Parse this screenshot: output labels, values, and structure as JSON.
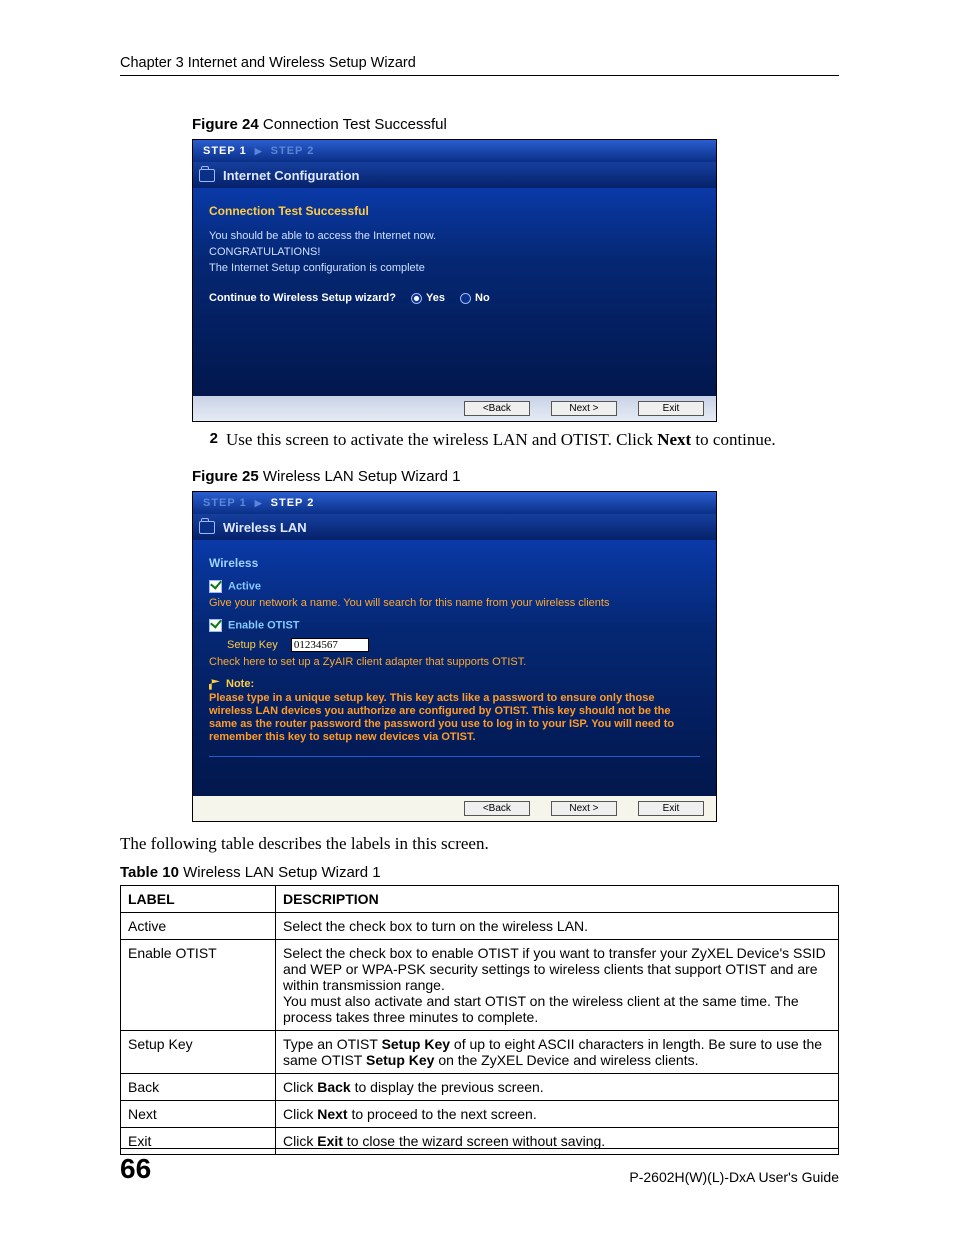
{
  "chapter": "Chapter 3 Internet and Wireless Setup Wizard",
  "page_number": "66",
  "guide_title": "P-2602H(W)(L)-DxA User's Guide",
  "fig24": {
    "caption_bold": "Figure 24",
    "caption_rest": "   Connection Test Successful",
    "step1": "STEP 1",
    "step2": "STEP 2",
    "title": "Internet Configuration",
    "sub": "Connection Test Successful",
    "line1": "You should be able to access the Internet now.",
    "line2": "CONGRATULATIONS!",
    "line3": "The Internet Setup configuration is complete",
    "question": "Continue to Wireless Setup wizard?",
    "yes": "Yes",
    "no": "No",
    "back": "<Back",
    "next": "Next >",
    "exit": "Exit"
  },
  "step2text": {
    "num": "2",
    "pre": "Use this screen to activate the wireless LAN and OTIST. Click ",
    "bold": "Next",
    "post": " to continue."
  },
  "fig25": {
    "caption_bold": "Figure 25",
    "caption_rest": "   Wireless LAN Setup Wizard 1",
    "step1": "STEP 1",
    "step2": "STEP 2",
    "title": "Wireless LAN",
    "sub": "Wireless",
    "active": "Active",
    "help1": "Give your network a name. You will search for this name from your wireless clients",
    "enable": "Enable OTIST",
    "setupkey_label": "Setup Key",
    "setupkey_value": "01234567",
    "help2": "Check here to set up a ZyAIR client adapter that supports OTIST.",
    "note_head": "Note:",
    "note_body": "Please type in a unique setup key. This key acts like a password to ensure only those wireless LAN devices you authorize are configured by OTIST. This key should not be the same as the router password the password you use to log in to your ISP. You will need to remember this key to setup new devices via OTIST.",
    "back": "<Back",
    "next": "Next >",
    "exit": "Exit"
  },
  "after_table_text": "The following table describes the labels in this screen.",
  "table_caption_bold": "Table 10",
  "table_caption_rest": "   Wireless LAN Setup Wizard 1",
  "table": {
    "h1": "LABEL",
    "h2": "DESCRIPTION",
    "rows": [
      {
        "label": "Active",
        "desc": "Select the check box to turn on the wireless LAN."
      },
      {
        "label": "Enable OTIST",
        "desc": "Select the check box to enable OTIST if you want to transfer your ZyXEL Device's SSID and WEP or WPA-PSK security settings to wireless clients that support OTIST and are within transmission range.",
        "desc2": "You must also activate and start OTIST on the wireless client at the same time. The process takes three minutes to complete."
      },
      {
        "label": "Setup Key",
        "desc_pre": "Type an OTIST ",
        "b1": "Setup Key",
        "desc_mid": " of up to eight ASCII characters in length. Be sure to use the same OTIST ",
        "b2": "Setup Key",
        "desc_post": " on the ZyXEL Device and wireless clients."
      },
      {
        "label": "Back",
        "desc_pre": "Click ",
        "b1": "Back",
        "desc_post": " to display the previous screen."
      },
      {
        "label": "Next",
        "desc_pre": "Click ",
        "b1": "Next",
        "desc_post": " to proceed to the next screen."
      },
      {
        "label": "Exit",
        "desc_pre": "Click ",
        "b1": "Exit",
        "desc_post": " to close the wizard screen without saving."
      }
    ]
  }
}
